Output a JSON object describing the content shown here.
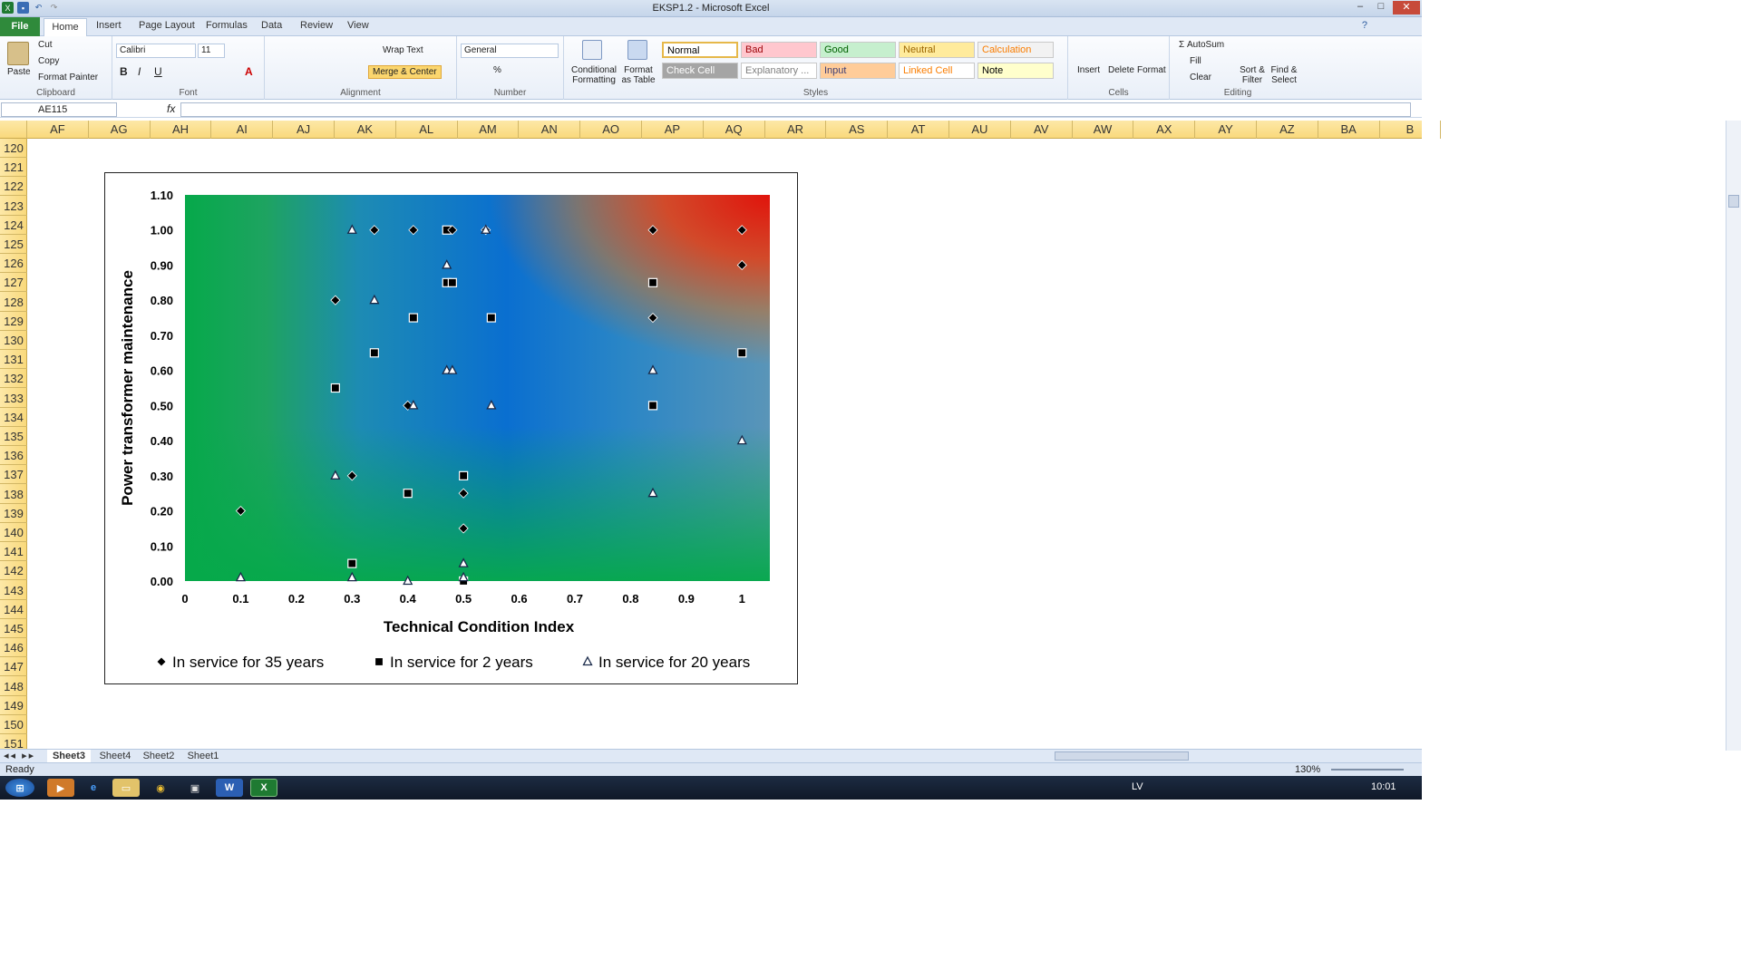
{
  "window": {
    "title": "EKSP1.2 - Microsoft Excel"
  },
  "tabs": [
    "File",
    "Home",
    "Insert",
    "Page Layout",
    "Formulas",
    "Data",
    "Review",
    "View"
  ],
  "ribbon": {
    "clipboard": {
      "paste": "Paste",
      "cut": "Cut",
      "copy": "Copy",
      "format_painter": "Format Painter",
      "label": "Clipboard"
    },
    "font": {
      "name": "Calibri",
      "size": "11",
      "label": "Font"
    },
    "alignment": {
      "wrap": "Wrap Text",
      "merge": "Merge & Center",
      "label": "Alignment"
    },
    "number": {
      "format": "General",
      "label": "Number"
    },
    "styles": {
      "conditional": "Conditional Formatting",
      "format_table": "Format as Table",
      "label": "Styles",
      "cells": [
        {
          "name": "Normal",
          "bg": "#ffffff",
          "fg": "#000000"
        },
        {
          "name": "Bad",
          "bg": "#ffc7ce",
          "fg": "#9c0006"
        },
        {
          "name": "Good",
          "bg": "#c6efce",
          "fg": "#006100"
        },
        {
          "name": "Neutral",
          "bg": "#ffeb9c",
          "fg": "#9c6500"
        },
        {
          "name": "Calculation",
          "bg": "#f2f2f2",
          "fg": "#fa7d00"
        },
        {
          "name": "Check Cell",
          "bg": "#a5a5a5",
          "fg": "#ffffff"
        },
        {
          "name": "Explanatory ...",
          "bg": "#ffffff",
          "fg": "#7f7f7f"
        },
        {
          "name": "Input",
          "bg": "#ffcc99",
          "fg": "#3f3f76"
        },
        {
          "name": "Linked Cell",
          "bg": "#ffffff",
          "fg": "#fa7d00"
        },
        {
          "name": "Note",
          "bg": "#ffffcc",
          "fg": "#000000"
        }
      ]
    },
    "cells": {
      "insert": "Insert",
      "delete": "Delete",
      "format": "Format",
      "label": "Cells"
    },
    "editing": {
      "autosum": "AutoSum",
      "fill": "Fill",
      "clear": "Clear",
      "sort": "Sort & Filter",
      "find": "Find & Select",
      "label": "Editing"
    }
  },
  "formula_bar": {
    "name_box": "AE115",
    "fx": "fx"
  },
  "columns": [
    "AF",
    "AG",
    "AH",
    "AI",
    "AJ",
    "AK",
    "AL",
    "AM",
    "AN",
    "AO",
    "AP",
    "AQ",
    "AR",
    "AS",
    "AT",
    "AU",
    "AV",
    "AW",
    "AX",
    "AY",
    "AZ",
    "BA",
    "B"
  ],
  "rows": [
    "120",
    "121",
    "122",
    "123",
    "124",
    "125",
    "126",
    "127",
    "128",
    "129",
    "130",
    "131",
    "132",
    "133",
    "134",
    "135",
    "136",
    "137",
    "138",
    "139",
    "140",
    "141",
    "142",
    "143",
    "144",
    "145",
    "146",
    "147",
    "148",
    "149",
    "150",
    "151"
  ],
  "sheets": [
    "Sheet3",
    "Sheet4",
    "Sheet2",
    "Sheet1"
  ],
  "status": {
    "ready": "Ready",
    "zoom": "130%"
  },
  "taskbar": {
    "lang": "LV",
    "time": "10:01"
  },
  "chart_data": {
    "type": "scatter",
    "title": "",
    "xlabel": "Technical Condition Index",
    "ylabel": "Power transformer maintenance",
    "xlim": [
      0,
      1.05
    ],
    "ylim": [
      0,
      1.1
    ],
    "xticks": [
      "0",
      "0.1",
      "0.2",
      "0.3",
      "0.4",
      "0.5",
      "0.6",
      "0.7",
      "0.8",
      "0.9",
      "1"
    ],
    "yticks": [
      "0.00",
      "0.10",
      "0.20",
      "0.30",
      "0.40",
      "0.50",
      "0.60",
      "0.70",
      "0.80",
      "0.90",
      "1.00",
      "1.10"
    ],
    "legend_position": "bottom",
    "series": [
      {
        "name": "In service for 35 years",
        "marker": "diamond",
        "points": [
          [
            0.1,
            0.2
          ],
          [
            0.27,
            0.8
          ],
          [
            0.3,
            0.3
          ],
          [
            0.34,
            1.0
          ],
          [
            0.4,
            0.5
          ],
          [
            0.41,
            1.0
          ],
          [
            0.48,
            1.0
          ],
          [
            0.5,
            0.25
          ],
          [
            0.5,
            0.15
          ],
          [
            0.54,
            1.0
          ],
          [
            0.84,
            1.0
          ],
          [
            0.84,
            0.75
          ],
          [
            1.0,
            1.0
          ],
          [
            1.0,
            0.9
          ]
        ]
      },
      {
        "name": "In service for 2 years",
        "marker": "square",
        "points": [
          [
            0.27,
            0.55
          ],
          [
            0.3,
            0.05
          ],
          [
            0.34,
            0.65
          ],
          [
            0.4,
            0.25
          ],
          [
            0.41,
            0.75
          ],
          [
            0.47,
            1.0
          ],
          [
            0.47,
            0.85
          ],
          [
            0.48,
            0.85
          ],
          [
            0.5,
            0.3
          ],
          [
            0.5,
            0.0
          ],
          [
            0.55,
            0.75
          ],
          [
            0.84,
            0.85
          ],
          [
            0.84,
            0.5
          ],
          [
            1.0,
            0.65
          ]
        ]
      },
      {
        "name": "In service for 20 years",
        "marker": "triangle",
        "points": [
          [
            0.1,
            0.01
          ],
          [
            0.27,
            0.3
          ],
          [
            0.3,
            1.0
          ],
          [
            0.3,
            0.01
          ],
          [
            0.34,
            0.8
          ],
          [
            0.4,
            0.0
          ],
          [
            0.41,
            0.5
          ],
          [
            0.47,
            0.9
          ],
          [
            0.47,
            0.6
          ],
          [
            0.48,
            0.6
          ],
          [
            0.5,
            0.05
          ],
          [
            0.5,
            0.01
          ],
          [
            0.54,
            1.0
          ],
          [
            0.55,
            0.5
          ],
          [
            0.84,
            0.6
          ],
          [
            0.84,
            0.25
          ],
          [
            1.0,
            0.4
          ]
        ]
      }
    ]
  }
}
